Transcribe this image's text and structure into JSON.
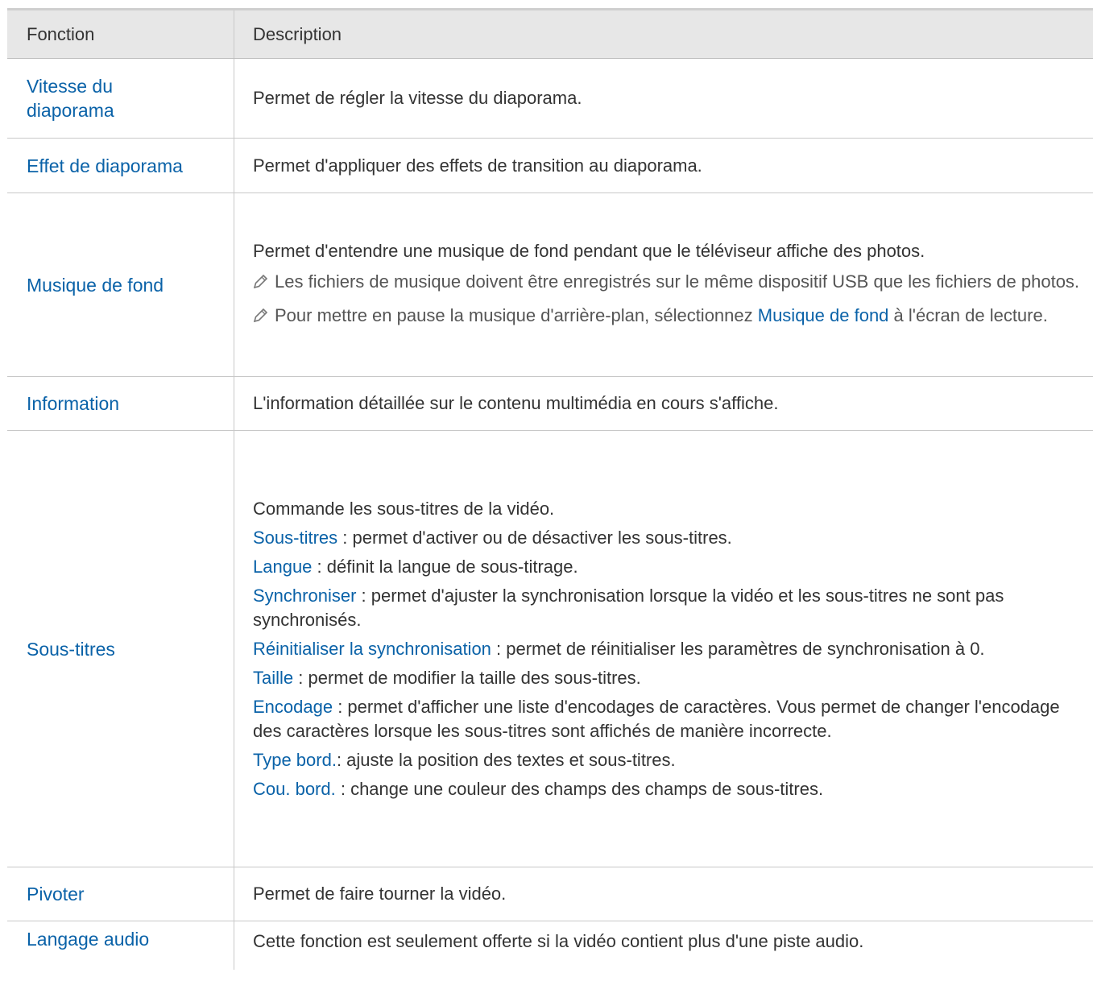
{
  "header": {
    "col1": "Fonction",
    "col2": "Description"
  },
  "rows": {
    "r0": {
      "name": "Vitesse du diaporama",
      "desc": "Permet de régler la vitesse du diaporama."
    },
    "r1": {
      "name": "Effet de diaporama",
      "desc": "Permet d'appliquer des effets de transition au diaporama."
    },
    "r2": {
      "name": "Musique de fond",
      "desc": "Permet d'entendre une musique de fond pendant que le téléviseur affiche des photos.",
      "note1": "Les fichiers de musique doivent être enregistrés sur le même dispositif USB que les fichiers de photos.",
      "note2_pre": "Pour mettre en pause la musique d'arrière-plan, sélectionnez ",
      "note2_kw": "Musique de fond",
      "note2_post": " à l'écran de lecture.",
      "note_icon": "pencil-icon"
    },
    "r3": {
      "name": "Information",
      "desc": "L'information détaillée sur le contenu multimédia en cours s'affiche."
    },
    "r4": {
      "name": "Sous-titres",
      "intro": "Commande les sous-titres de la vidéo.",
      "items": [
        {
          "kw": "Sous-titres",
          "text": " : permet d'activer ou de désactiver les sous-titres."
        },
        {
          "kw": "Langue",
          "text": " : définit la langue de sous-titrage."
        },
        {
          "kw": "Synchroniser",
          "text": " : permet d'ajuster la synchronisation lorsque la vidéo et les sous-titres ne sont pas synchronisés."
        },
        {
          "kw": "Réinitialiser la synchronisation",
          "text": " : permet de réinitialiser les paramètres de synchronisation à 0."
        },
        {
          "kw": "Taille",
          "text": " : permet de modifier la taille des sous-titres."
        },
        {
          "kw": "Encodage",
          "text": " : permet d'afficher une liste d'encodages de caractères. Vous permet de changer l'encodage des caractères lorsque les sous-titres sont affichés de manière incorrecte."
        },
        {
          "kw": "Type bord.",
          "text": ": ajuste la position des textes et sous-titres."
        },
        {
          "kw": "Cou. bord.",
          "text": " : change une couleur des champs des champs de sous-titres."
        }
      ]
    },
    "r5": {
      "name": "Pivoter",
      "desc": "Permet de faire tourner la vidéo."
    },
    "r6": {
      "name": "Langage audio",
      "desc": "Cette fonction est seulement offerte si la vidéo contient plus d'une piste audio."
    }
  },
  "colors": {
    "link": "#0a62a8",
    "header_bg": "#e7e7e7",
    "border": "#c8c8c8"
  }
}
